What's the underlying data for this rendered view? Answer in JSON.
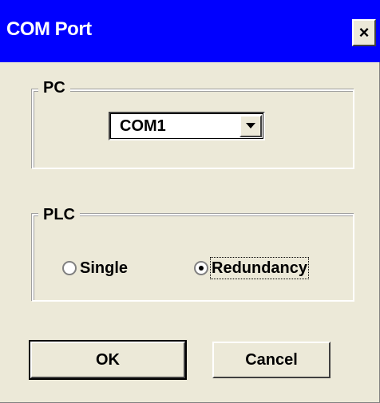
{
  "window": {
    "title": "COM Port",
    "close_label": "×"
  },
  "pc_group": {
    "label": "PC",
    "port_select": {
      "value": "COM1"
    }
  },
  "plc_group": {
    "label": "PLC",
    "options": [
      {
        "label": "Single",
        "selected": false
      },
      {
        "label": "Redundancy",
        "selected": true
      }
    ]
  },
  "buttons": {
    "ok_label": "OK",
    "cancel_label": "Cancel"
  },
  "colors": {
    "titlebar": "#0000ff",
    "dialog_bg": "#ece9d8"
  }
}
